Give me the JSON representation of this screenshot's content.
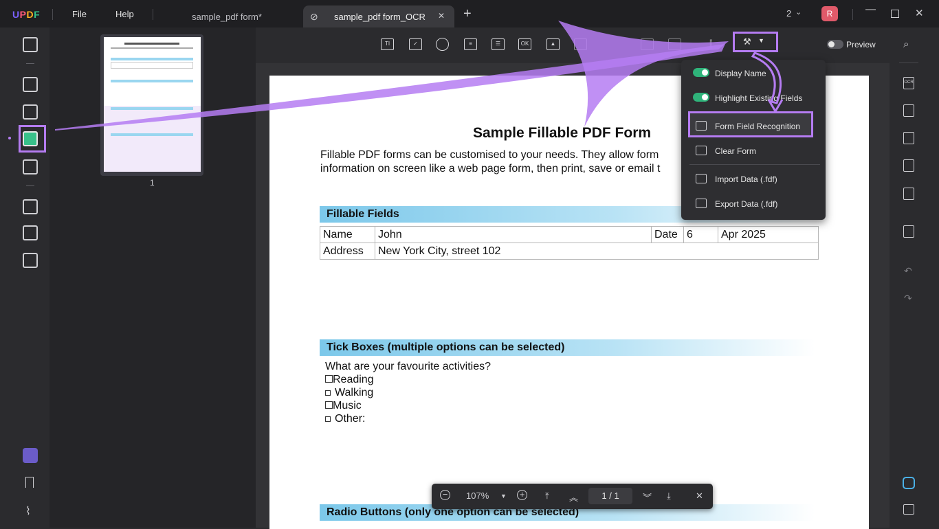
{
  "app": {
    "logo": "UPDF"
  },
  "menu": {
    "file": "File",
    "help": "Help"
  },
  "tabs": [
    {
      "label": "sample_pdf form*",
      "active": false
    },
    {
      "label": "sample_pdf form_OCR",
      "active": true
    }
  ],
  "titlebar": {
    "window_count": "2",
    "avatar_letter": "R",
    "new_tab": "+",
    "tab_close": "✕"
  },
  "thumbnail": {
    "page_number": "1"
  },
  "toolbar": {
    "preview_label": "Preview",
    "icons": [
      "text-field-icon",
      "checkbox-icon",
      "radio-button-icon",
      "combo-box-icon",
      "list-box-icon",
      "button-field-icon",
      "image-field-icon",
      "date-field-icon",
      "signature-field-icon",
      "grid-icon",
      "align-icon",
      "form-tools-icon"
    ],
    "ok_label": "OK"
  },
  "dropdown": {
    "display_name": "Display Name",
    "highlight_fields": "Highlight Existing Fields",
    "form_field_recognition": "Form Field Recognition",
    "clear_form": "Clear Form",
    "import_data": "Import Data (.fdf)",
    "export_data": "Export Data (.fdf)"
  },
  "document": {
    "title": "Sample Fillable PDF Form",
    "intro_line1": "Fillable PDF forms can be customised to your needs. They allow form",
    "intro_line2": "information on screen like a web page form, then print, save or email t",
    "section_fillable": "Fillable Fields",
    "name_label": "Name",
    "name_value": "John",
    "date_label": "Date",
    "date_day": "6",
    "date_value": "Apr 2025",
    "address_label": "Address",
    "address_value": "New York City, street 102",
    "section_tick": "Tick Boxes (multiple options can be selected)",
    "tick_question": "What are your favourite activities?",
    "tick_options": [
      "Reading",
      "Walking",
      "Music",
      "Other:"
    ],
    "section_radio": "Radio Buttons (only one option can be selected)"
  },
  "bottom_nav": {
    "zoom": "107%",
    "page_current": "1",
    "page_sep": "/",
    "page_total": "1"
  },
  "right_rail": {
    "ocr_label": "OCR"
  },
  "colors": {
    "accent_purple": "#b57cf2",
    "toggle_green": "#2fb37a",
    "active_rail": "#38c18a"
  }
}
